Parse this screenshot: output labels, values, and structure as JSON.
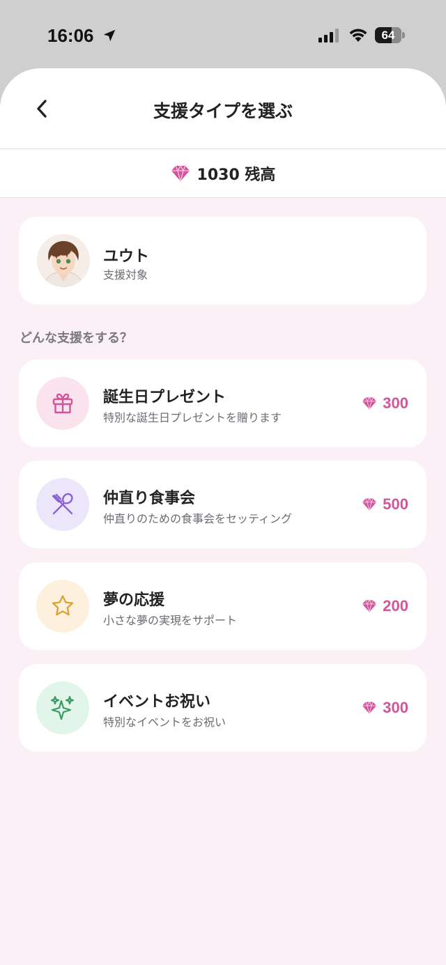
{
  "status_bar": {
    "time": "16:06",
    "battery": "64",
    "battery_level": 0.64
  },
  "header": {
    "title": "支援タイプを選ぶ"
  },
  "balance": {
    "text": "1030 残高"
  },
  "recipient": {
    "name": "ユウト",
    "subtitle": "支援対象"
  },
  "section_label": "どんな支援をする？",
  "options": [
    {
      "title": "誕生日プレゼント",
      "description": "特別な誕生日プレゼントを贈ります",
      "price": "300",
      "icon": "gift-icon",
      "icon_bg": "#fbe3ee",
      "icon_color": "#d2549b"
    },
    {
      "title": "仲直り食事会",
      "description": "仲直りのための食事会をセッティング",
      "price": "500",
      "icon": "utensils-icon",
      "icon_bg": "#ece6fb",
      "icon_color": "#8a63d2"
    },
    {
      "title": "夢の応援",
      "description": "小さな夢の実現をサポート",
      "price": "200",
      "icon": "star-icon",
      "icon_bg": "#fdf1dd",
      "icon_color": "#d9a233"
    },
    {
      "title": "イベントお祝い",
      "description": "特別なイベントをお祝い",
      "price": "300",
      "icon": "sparkles-icon",
      "icon_bg": "#e1f5ea",
      "icon_color": "#3a9a68"
    }
  ],
  "colors": {
    "accent": "#d2549b",
    "sheet_bg": "#fbf0f6"
  }
}
